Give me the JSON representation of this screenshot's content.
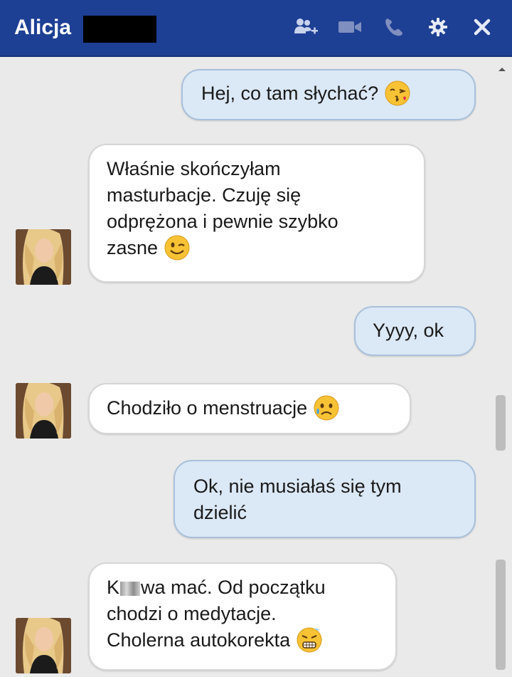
{
  "window": {
    "contact_name": "Alicja",
    "icons": [
      "add-person-icon",
      "video-call-icon",
      "phone-icon",
      "gear-icon",
      "close-icon"
    ],
    "header_color": "#1d3f94"
  },
  "messages": [
    {
      "sender": "me",
      "text": "Hej, co tam słychać?",
      "emoji": "kissing-face-emoji"
    },
    {
      "sender": "contact",
      "lines": [
        "Właśnie skończyłam",
        "masturbacje. Czuję się",
        "odprężona i pewnie szybko",
        "zasne"
      ],
      "emoji": "winking-face-emoji"
    },
    {
      "sender": "me",
      "text": "Yyyy, ok"
    },
    {
      "sender": "contact",
      "text": "Chodziło o menstruacje",
      "emoji": "sad-sweat-face-emoji"
    },
    {
      "sender": "me",
      "lines": [
        "Ok, nie musiałaś się tym",
        "dzielić"
      ]
    },
    {
      "sender": "contact",
      "lines": [
        "K",
        "wa mać. Od początku",
        "chodzi o medytacje.",
        "Cholerna autokorekta"
      ],
      "emoji": "grimacing-face-emoji"
    }
  ],
  "colors": {
    "outgoing_bubble": "#dbe8f6",
    "incoming_bubble": "#ffffff",
    "background": "#eaeaea"
  }
}
